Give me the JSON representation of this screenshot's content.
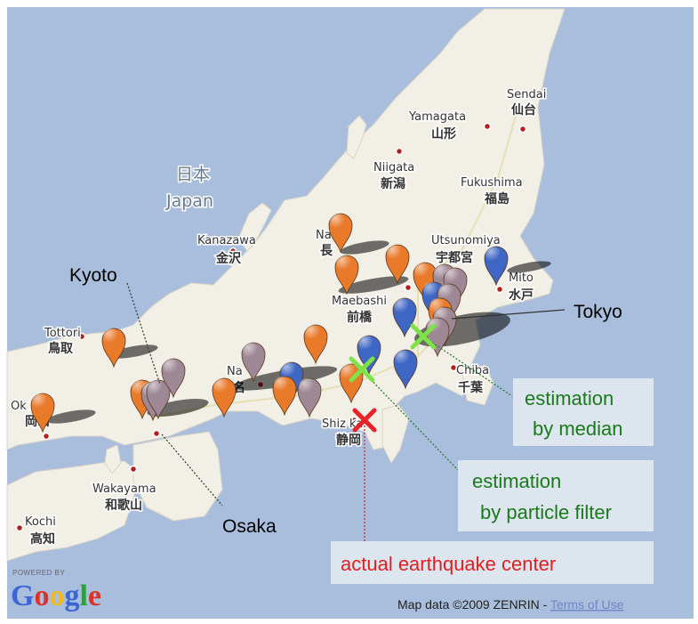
{
  "map": {
    "country_labels": {
      "kanji": "日本",
      "english": "Japan"
    },
    "cities": [
      {
        "key": "sendai",
        "en": "Sendai",
        "ja": "仙台"
      },
      {
        "key": "yamagata",
        "en": "Yamagata",
        "ja": "山形"
      },
      {
        "key": "niigata",
        "en": "Niigata",
        "ja": "新潟"
      },
      {
        "key": "fukushima",
        "en": "Fukushima",
        "ja": "福島"
      },
      {
        "key": "utsunomiya",
        "en": "Utsunomiya",
        "ja": "宇都宮"
      },
      {
        "key": "mito",
        "en": "Mito",
        "ja": "水戸"
      },
      {
        "key": "nagano",
        "en": "Na    no",
        "ja": "長  "
      },
      {
        "key": "maebashi",
        "en": "Maebashi",
        "ja": "前橋"
      },
      {
        "key": "kanazawa",
        "en": "Kanazawa",
        "ja": "金沢"
      },
      {
        "key": "tottori",
        "en": "Tottori",
        "ja": "鳥取"
      },
      {
        "key": "okayama",
        "en": "Ok    ma",
        "ja": "岡山"
      },
      {
        "key": "nagoya",
        "en": "Na    ",
        "ja": "名"
      },
      {
        "key": "shizuoka",
        "en": "Shiz  ka",
        "ja": "静岡"
      },
      {
        "key": "chiba",
        "en": "Chiba",
        "ja": "千葉"
      },
      {
        "key": "wakayama",
        "en": "Wakayama",
        "ja": "和歌山"
      },
      {
        "key": "kochi",
        "en": "Kochi",
        "ja": "高知"
      }
    ],
    "colors": {
      "sea": "#a9bedc",
      "land": "#f2efe6",
      "marker_orange": "#e97a2a",
      "marker_blue": "#3e66c4",
      "marker_purple": "#9f8895",
      "median_cross": "#7ee24a",
      "actual_cross": "#e8242a"
    }
  },
  "annotations": {
    "kyoto": "Kyoto",
    "osaka": "Osaka",
    "tokyo": "Tokyo",
    "median_line1": "estimation",
    "median_line2": "by median",
    "particle_line1": "estimation",
    "particle_line2": "by particle filter",
    "actual_center": "actual earthquake center"
  },
  "branding": {
    "powered_by": "POWERED BY",
    "google": "Google"
  },
  "footer": {
    "attribution": "Map data ©2009 ZENRIN - ",
    "terms": "Terms of Use"
  }
}
